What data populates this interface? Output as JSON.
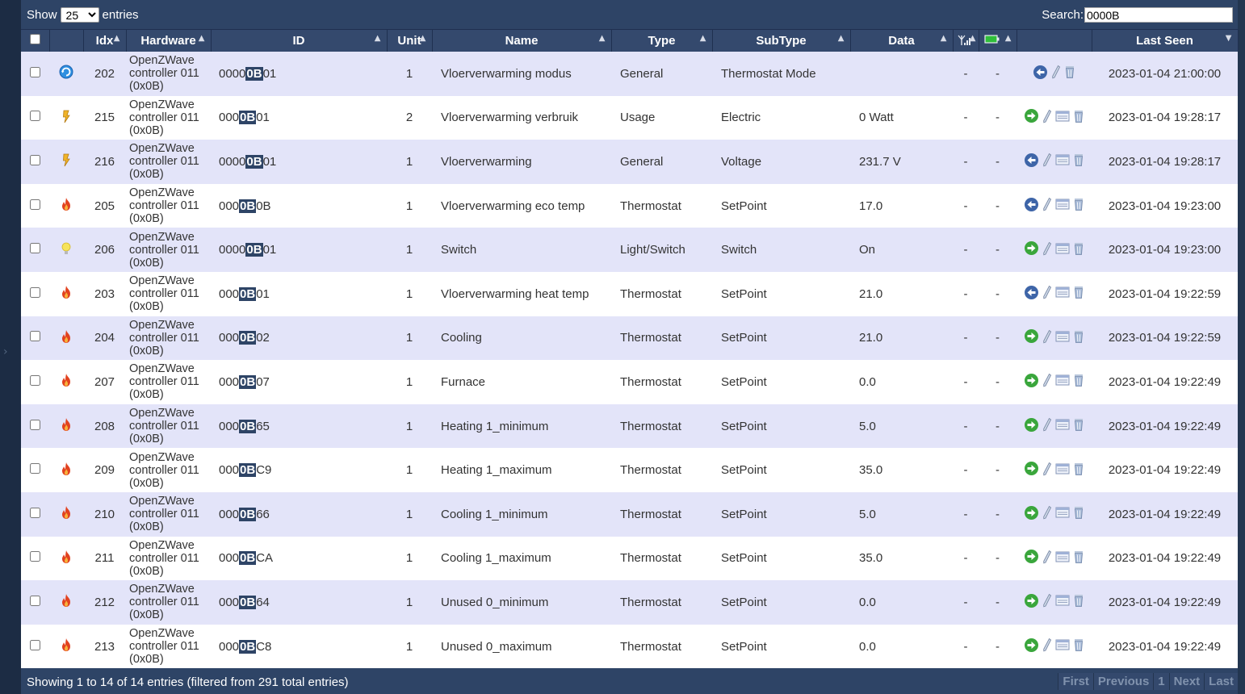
{
  "top": {
    "show_label": "Show",
    "page_size": "25",
    "entries_label": "entries",
    "search_label": "Search:",
    "search_value": "0000B"
  },
  "columns": {
    "idx": "Idx",
    "hardware": "Hardware",
    "id": "ID",
    "unit": "Unit",
    "name": "Name",
    "type": "Type",
    "subtype": "SubType",
    "data": "Data",
    "last_seen": "Last Seen"
  },
  "rows": [
    {
      "icon": "thermostat-mode",
      "idx": "202",
      "hw": [
        "OpenZWave",
        "controller 011",
        "(0x0B)"
      ],
      "id": [
        "0000",
        "0B",
        "01"
      ],
      "unit": "1",
      "name": "Vloerverwarming modus",
      "type": "General",
      "sub": "Thermostat Mode",
      "data": "",
      "sig": "-",
      "bat": "-",
      "actions": [
        "back",
        "edit",
        "trash"
      ],
      "seen": "2023-01-04 21:00:00"
    },
    {
      "icon": "usage",
      "idx": "215",
      "hw": [
        "OpenZWave",
        "controller 011",
        "(0x0B)"
      ],
      "id": [
        "000",
        "0B",
        "01"
      ],
      "unit": "2",
      "name": "Vloerverwarming verbruik",
      "type": "Usage",
      "sub": "Electric",
      "data": "0 Watt",
      "sig": "-",
      "bat": "-",
      "actions": [
        "forward",
        "edit",
        "log",
        "trash"
      ],
      "seen": "2023-01-04 19:28:17"
    },
    {
      "icon": "usage",
      "idx": "216",
      "hw": [
        "OpenZWave",
        "controller 011",
        "(0x0B)"
      ],
      "id": [
        "0000",
        "0B",
        "01"
      ],
      "unit": "1",
      "name": "Vloerverwarming",
      "type": "General",
      "sub": "Voltage",
      "data": "231.7 V",
      "sig": "-",
      "bat": "-",
      "actions": [
        "back",
        "edit",
        "log",
        "trash"
      ],
      "seen": "2023-01-04 19:28:17"
    },
    {
      "icon": "flame",
      "idx": "205",
      "hw": [
        "OpenZWave",
        "controller 011",
        "(0x0B)"
      ],
      "id": [
        "000",
        "0B",
        "0B"
      ],
      "unit": "1",
      "name": "Vloerverwarming eco temp",
      "type": "Thermostat",
      "sub": "SetPoint",
      "data": "17.0",
      "sig": "-",
      "bat": "-",
      "actions": [
        "back",
        "edit",
        "log",
        "trash"
      ],
      "seen": "2023-01-04 19:23:00"
    },
    {
      "icon": "bulb",
      "idx": "206",
      "hw": [
        "OpenZWave",
        "controller 011",
        "(0x0B)"
      ],
      "id": [
        "0000",
        "0B",
        "01"
      ],
      "unit": "1",
      "name": "Switch",
      "type": "Light/Switch",
      "sub": "Switch",
      "data": "On",
      "sig": "-",
      "bat": "-",
      "actions": [
        "forward",
        "edit",
        "log",
        "trash"
      ],
      "seen": "2023-01-04 19:23:00"
    },
    {
      "icon": "flame",
      "idx": "203",
      "hw": [
        "OpenZWave",
        "controller 011",
        "(0x0B)"
      ],
      "id": [
        "000",
        "0B",
        "01"
      ],
      "unit": "1",
      "name": "Vloerverwarming heat temp",
      "type": "Thermostat",
      "sub": "SetPoint",
      "data": "21.0",
      "sig": "-",
      "bat": "-",
      "actions": [
        "back",
        "edit",
        "log",
        "trash"
      ],
      "seen": "2023-01-04 19:22:59"
    },
    {
      "icon": "flame",
      "idx": "204",
      "hw": [
        "OpenZWave",
        "controller 011",
        "(0x0B)"
      ],
      "id": [
        "000",
        "0B",
        "02"
      ],
      "unit": "1",
      "name": "Cooling",
      "type": "Thermostat",
      "sub": "SetPoint",
      "data": "21.0",
      "sig": "-",
      "bat": "-",
      "actions": [
        "forward",
        "edit",
        "log",
        "trash"
      ],
      "seen": "2023-01-04 19:22:59"
    },
    {
      "icon": "flame",
      "idx": "207",
      "hw": [
        "OpenZWave",
        "controller 011",
        "(0x0B)"
      ],
      "id": [
        "000",
        "0B",
        "07"
      ],
      "unit": "1",
      "name": "Furnace",
      "type": "Thermostat",
      "sub": "SetPoint",
      "data": "0.0",
      "sig": "-",
      "bat": "-",
      "actions": [
        "forward",
        "edit",
        "log",
        "trash"
      ],
      "seen": "2023-01-04 19:22:49"
    },
    {
      "icon": "flame",
      "idx": "208",
      "hw": [
        "OpenZWave",
        "controller 011",
        "(0x0B)"
      ],
      "id": [
        "000",
        "0B",
        "65"
      ],
      "unit": "1",
      "name": "Heating 1_minimum",
      "type": "Thermostat",
      "sub": "SetPoint",
      "data": "5.0",
      "sig": "-",
      "bat": "-",
      "actions": [
        "forward",
        "edit",
        "log",
        "trash"
      ],
      "seen": "2023-01-04 19:22:49"
    },
    {
      "icon": "flame",
      "idx": "209",
      "hw": [
        "OpenZWave",
        "controller 011",
        "(0x0B)"
      ],
      "id": [
        "000",
        "0B",
        "C9"
      ],
      "unit": "1",
      "name": "Heating 1_maximum",
      "type": "Thermostat",
      "sub": "SetPoint",
      "data": "35.0",
      "sig": "-",
      "bat": "-",
      "actions": [
        "forward",
        "edit",
        "log",
        "trash"
      ],
      "seen": "2023-01-04 19:22:49"
    },
    {
      "icon": "flame",
      "idx": "210",
      "hw": [
        "OpenZWave",
        "controller 011",
        "(0x0B)"
      ],
      "id": [
        "000",
        "0B",
        "66"
      ],
      "unit": "1",
      "name": "Cooling 1_minimum",
      "type": "Thermostat",
      "sub": "SetPoint",
      "data": "5.0",
      "sig": "-",
      "bat": "-",
      "actions": [
        "forward",
        "edit",
        "log",
        "trash"
      ],
      "seen": "2023-01-04 19:22:49"
    },
    {
      "icon": "flame",
      "idx": "211",
      "hw": [
        "OpenZWave",
        "controller 011",
        "(0x0B)"
      ],
      "id": [
        "000",
        "0B",
        "CA"
      ],
      "unit": "1",
      "name": "Cooling 1_maximum",
      "type": "Thermostat",
      "sub": "SetPoint",
      "data": "35.0",
      "sig": "-",
      "bat": "-",
      "actions": [
        "forward",
        "edit",
        "log",
        "trash"
      ],
      "seen": "2023-01-04 19:22:49"
    },
    {
      "icon": "flame",
      "idx": "212",
      "hw": [
        "OpenZWave",
        "controller 011",
        "(0x0B)"
      ],
      "id": [
        "000",
        "0B",
        "64"
      ],
      "unit": "1",
      "name": "Unused 0_minimum",
      "type": "Thermostat",
      "sub": "SetPoint",
      "data": "0.0",
      "sig": "-",
      "bat": "-",
      "actions": [
        "forward",
        "edit",
        "log",
        "trash"
      ],
      "seen": "2023-01-04 19:22:49"
    },
    {
      "icon": "flame",
      "idx": "213",
      "hw": [
        "OpenZWave",
        "controller 011",
        "(0x0B)"
      ],
      "id": [
        "000",
        "0B",
        "C8"
      ],
      "unit": "1",
      "name": "Unused 0_maximum",
      "type": "Thermostat",
      "sub": "SetPoint",
      "data": "0.0",
      "sig": "-",
      "bat": "-",
      "actions": [
        "forward",
        "edit",
        "log",
        "trash"
      ],
      "seen": "2023-01-04 19:22:49"
    }
  ],
  "footer": {
    "info": "Showing 1 to 14 of 14 entries (filtered from 291 total entries)",
    "first": "First",
    "previous": "Previous",
    "page": "1",
    "next": "Next",
    "last": "Last"
  },
  "colors": {
    "background": "#2e4466",
    "header": "#34496d",
    "row_odd": "#e3e4f9",
    "row_even": "#ffffff"
  }
}
